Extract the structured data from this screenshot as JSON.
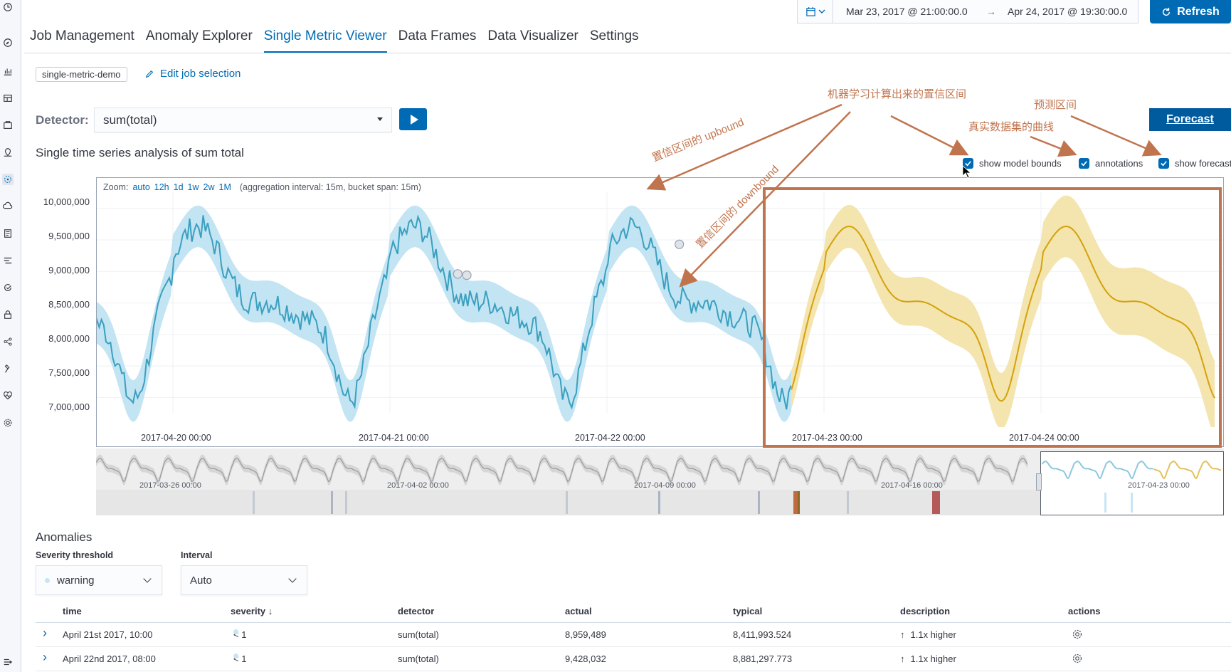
{
  "header": {
    "date_start": "Mar 23, 2017 @ 21:00:00.0",
    "date_arrow": "→",
    "date_end": "Apr 24, 2017 @ 19:30:00.0",
    "refresh_label": "Refresh"
  },
  "tabs": [
    "Job Management",
    "Anomaly Explorer",
    "Single Metric Viewer",
    "Data Frames",
    "Data Visualizer",
    "Settings"
  ],
  "active_tab": "Single Metric Viewer",
  "job": {
    "badge": "single-metric-demo",
    "edit_label": "Edit job selection"
  },
  "detector": {
    "label": "Detector:",
    "value": "sum(total)"
  },
  "chart_title": "Single time series analysis of sum total",
  "forecast_label": "Forecast",
  "checkboxes": {
    "model_bounds": "show model bounds",
    "annotations": "annotations",
    "forecast": "show forecast"
  },
  "annotations": {
    "confidence": "机器学习计算出来的置信区间",
    "forecast_range": "预测区间",
    "real_curve": "真实数据集的曲线",
    "upbound": "置信区间的 upbound",
    "downbound": "置信区间的 downbound"
  },
  "zoom": {
    "label": "Zoom:",
    "options": [
      "auto",
      "12h",
      "1d",
      "1w",
      "2w",
      "1M"
    ],
    "interval_note": "(aggregation interval: 15m, bucket span: 15m)"
  },
  "chart_data": {
    "type": "line",
    "y_ticks": [
      "10,000,000",
      "9,500,000",
      "9,000,000",
      "8,500,000",
      "8,000,000",
      "7,500,000",
      "7,000,000"
    ],
    "x_ticks": [
      "2017-04-20 00:00",
      "2017-04-21 00:00",
      "2017-04-22 00:00",
      "2017-04-23 00:00",
      "2017-04-24 00:00"
    ],
    "ylim": [
      6700000,
      10200000
    ],
    "xlim_days": [
      "2017-04-19 03:45",
      "2017-04-24 19:30"
    ],
    "series": [
      {
        "name": "actual",
        "color": "#3aa0c0"
      },
      {
        "name": "model bounds",
        "color": "#b9dff0"
      },
      {
        "name": "forecast",
        "color": "#d4a20a"
      },
      {
        "name": "forecast bounds",
        "color": "#f2dfa0"
      }
    ],
    "anomaly_markers": [
      {
        "x": "2017-04-21 07:30",
        "y": 8960000
      },
      {
        "x": "2017-04-21 08:30",
        "y": 8940000
      },
      {
        "x": "2017-04-22 08:00",
        "y": 9430000
      }
    ],
    "overview_ticks": [
      "2017-03-26 00:00",
      "2017-04-02 00:00",
      "2017-04-09 00:00",
      "2017-04-16 00:00",
      "2017-04-23 00:00"
    ]
  },
  "anomalies": {
    "title": "Anomalies",
    "severity_label": "Severity threshold",
    "severity_value": "warning",
    "interval_label": "Interval",
    "interval_value": "Auto",
    "columns": [
      "time",
      "severity",
      "detector",
      "actual",
      "typical",
      "description",
      "actions"
    ],
    "rows": [
      {
        "time": "April 21st 2017, 10:00",
        "severity": "< 1",
        "detector": "sum(total)",
        "actual": "8,959,489",
        "typical": "8,411,993.524",
        "description": "1.1x higher"
      },
      {
        "time": "April 22nd 2017, 08:00",
        "severity": "< 1",
        "detector": "sum(total)",
        "actual": "9,428,032",
        "typical": "8,881,297.773",
        "description": "1.1x higher"
      }
    ]
  }
}
